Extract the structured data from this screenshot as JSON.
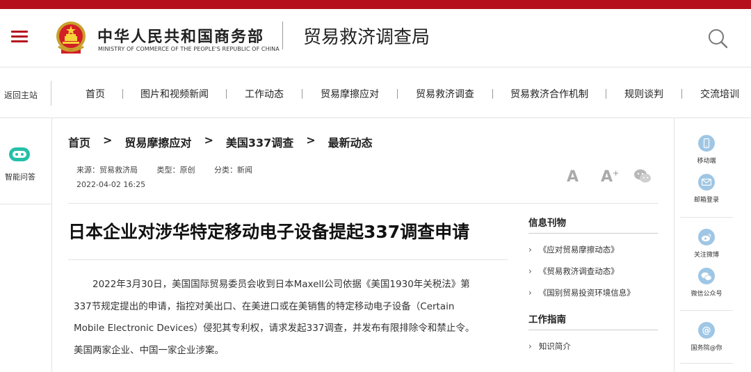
{
  "colors": {
    "accent_red": "#b50f1b",
    "rail_icon_blue": "#9fc6e4",
    "robot_green": "#25c0a8"
  },
  "header": {
    "menu_icon": "hamburger-icon",
    "emblem_icon": "national-emblem-icon",
    "ministry_cn": "中华人民共和国商务部",
    "ministry_en": "MINISTRY OF COMMERCE OF THE PEOPLE'S REPUBLIC OF CHINA",
    "bureau": "贸易救济调查局",
    "search_icon": "search-icon"
  },
  "nav": {
    "back_home": "返回主站",
    "items": [
      "首页",
      "图片和视频新闻",
      "工作动态",
      "贸易摩擦应对",
      "贸易救济调查",
      "贸易救济合作机制",
      "规则谈判",
      "交流培训"
    ]
  },
  "left_rail": {
    "robot_icon": "chat-robot-icon",
    "label": "智能问答"
  },
  "breadcrumb": {
    "items": [
      "首页",
      "贸易摩擦应对",
      "美国337调查",
      "最新动态"
    ],
    "separator": ">"
  },
  "meta": {
    "source": "来源：贸易救济局",
    "type": "类型：原创",
    "category": "分类：新闻",
    "date": "2022-04-02 16:25"
  },
  "tools": {
    "font_large": "A",
    "font_increase": "A",
    "font_increase_mark": "+",
    "share_icon": "wechat-icon"
  },
  "article": {
    "title": "日本企业对涉华特定移动电子设备提起337调查申请",
    "body": "2022年3月30日，美国国际贸易委员会收到日本Maxell公司依据《美国1930年关税法》第337节规定提出的申请，指控对美出口、在美进口或在美销售的特定移动电子设备（Certain Mobile Electronic Devices）侵犯其专利权，请求发起337调查，并发布有限排除令和禁止令。美国两家企业、中国一家企业涉案。"
  },
  "sidebar": {
    "section1_title": "信息刊物",
    "section1_items": [
      "《应对贸易摩擦动态》",
      "《贸易救济调查动态》",
      "《国别贸易投资环境信息》"
    ],
    "section2_title": "工作指南",
    "section2_items": [
      "知识简介"
    ]
  },
  "right_rail": {
    "items": [
      {
        "label": "移动端",
        "icon": "mobile-phone-icon"
      },
      {
        "label": "邮箱登录",
        "icon": "mail-icon"
      },
      {
        "label": "关注微博",
        "icon": "weibo-icon"
      },
      {
        "label": "微信公众号",
        "icon": "wechat-icon"
      },
      {
        "label": "国务院@你",
        "icon": "at-sign-icon"
      }
    ]
  }
}
